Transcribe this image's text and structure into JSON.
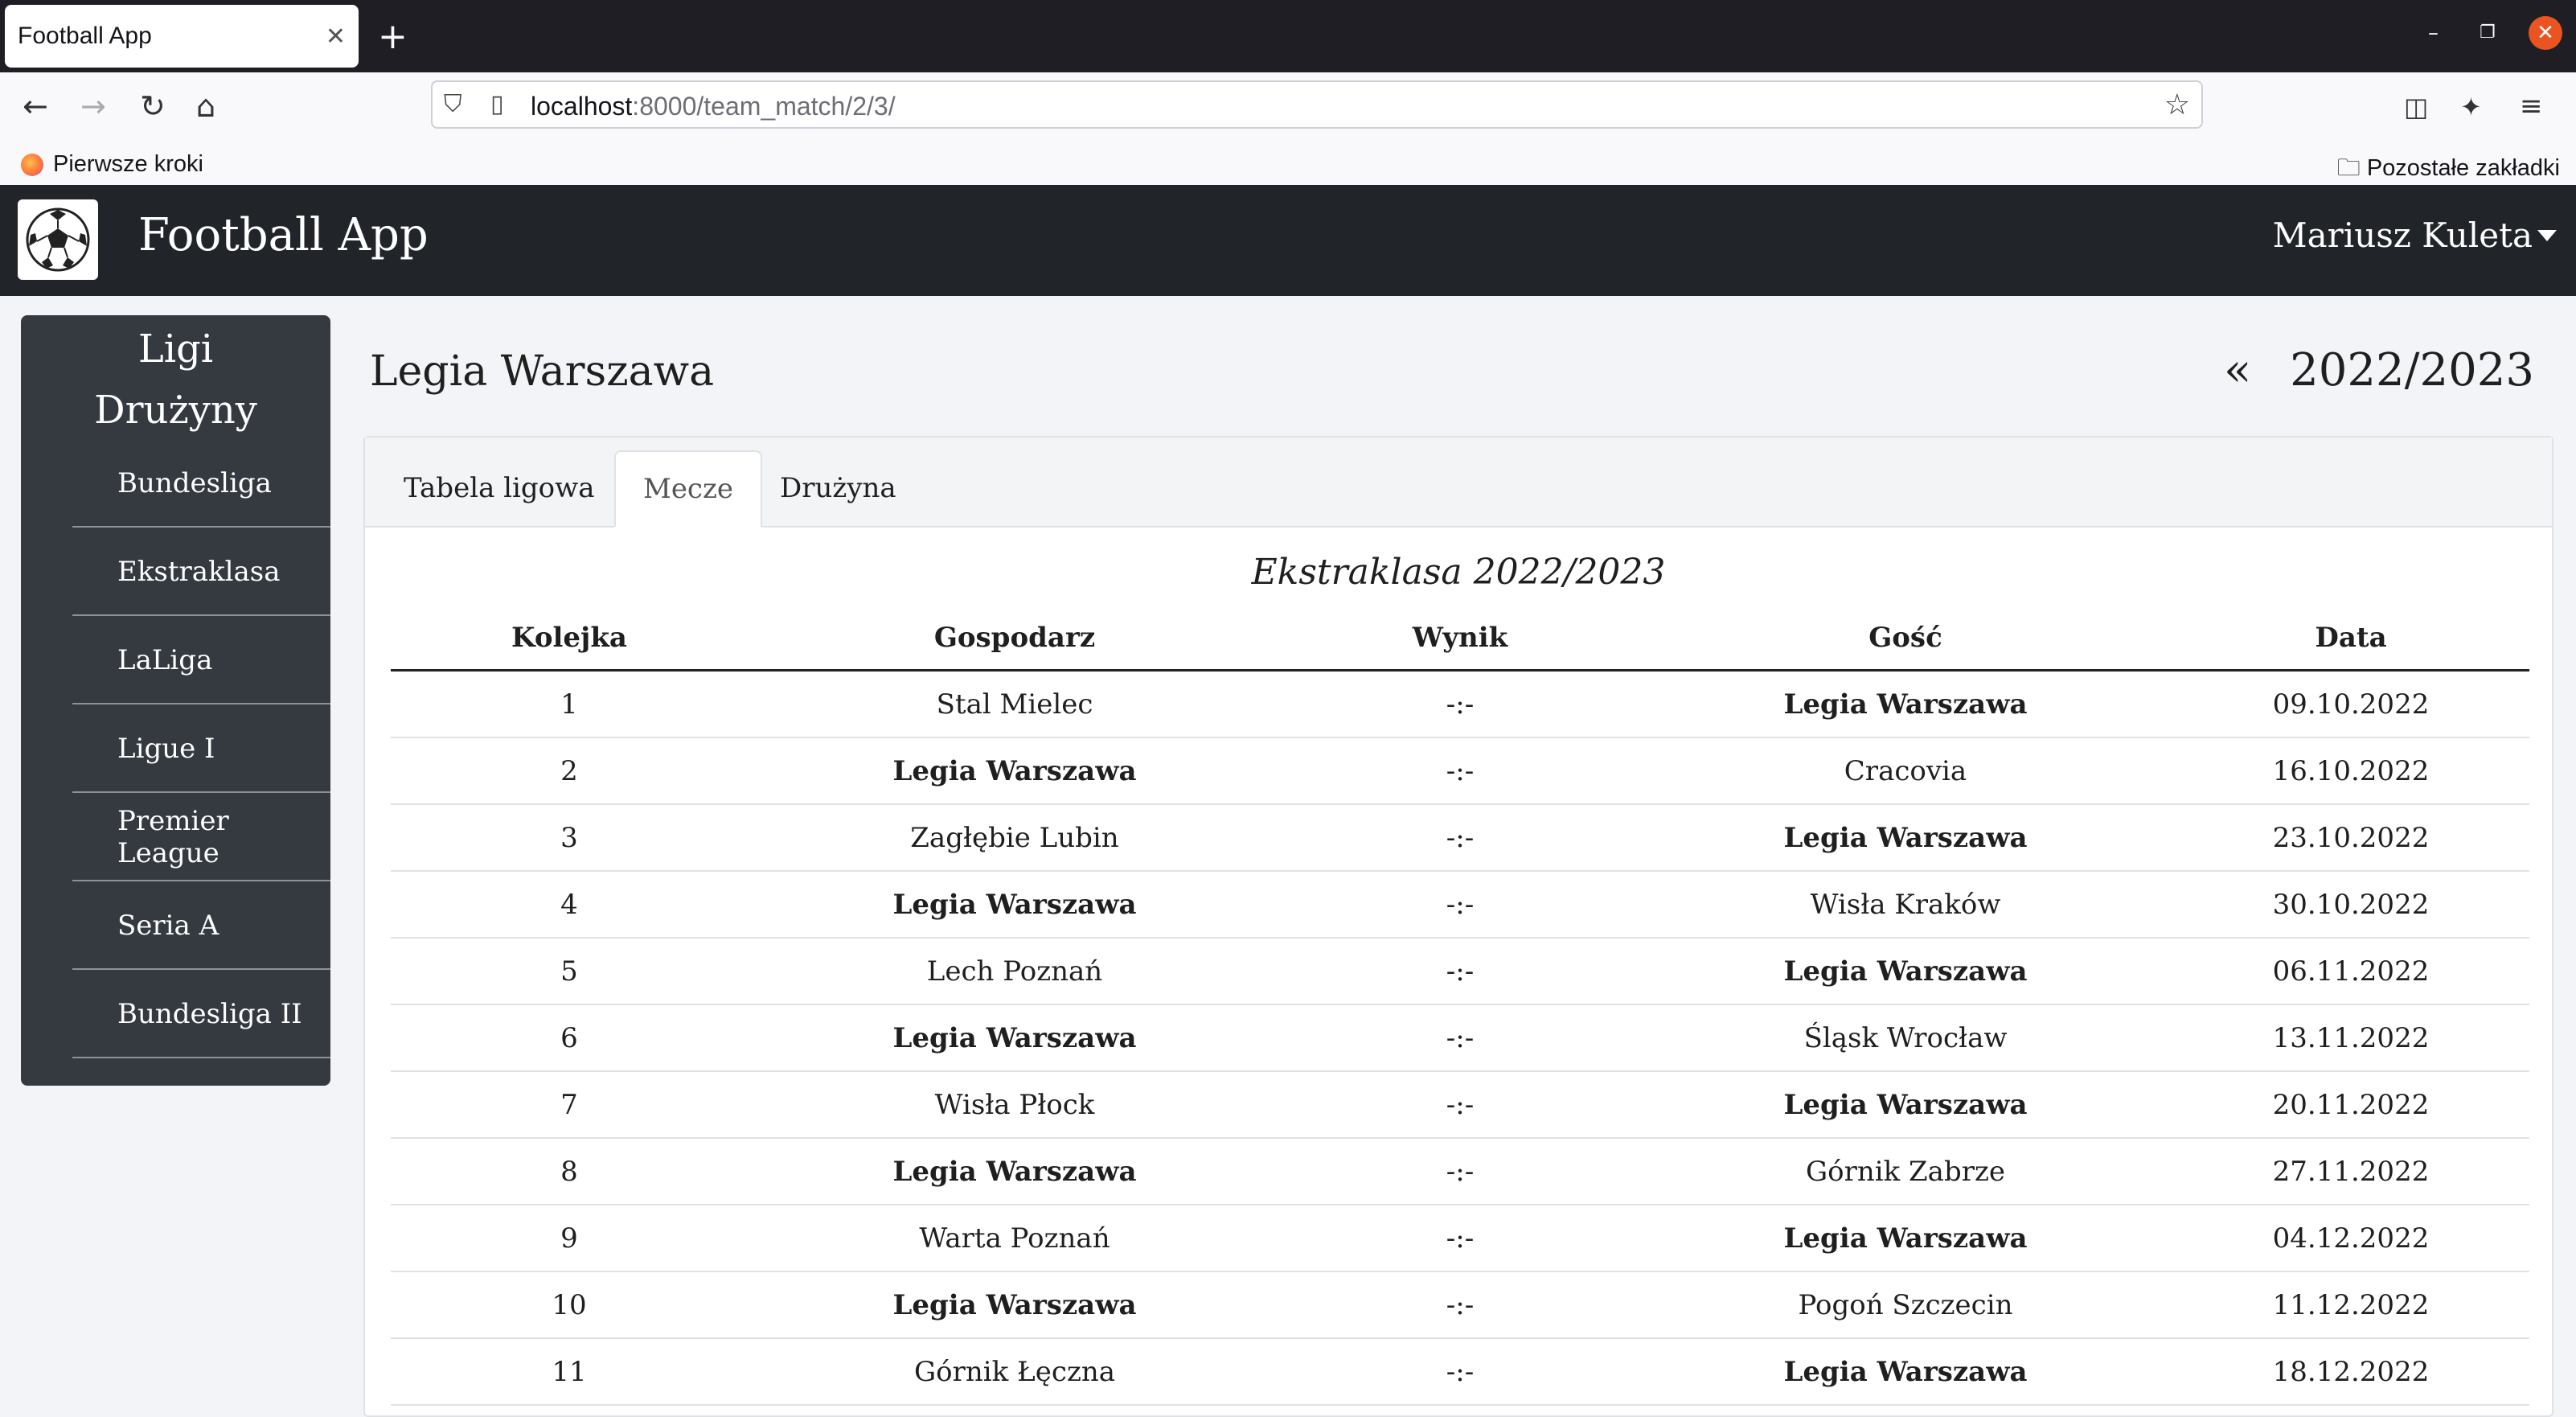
{
  "browser": {
    "tab_title": "Football App",
    "url_host": "localhost",
    "url_rest": ":8000/team_match/2/3/",
    "bookmark_first": "Pierwsze kroki",
    "bookmark_other": "Pozostałe zakładki"
  },
  "app": {
    "brand": "Football App",
    "user": "Mariusz Kuleta"
  },
  "sidebar": {
    "heading_leagues": "Ligi",
    "heading_teams": "Drużyny",
    "items": [
      {
        "label": "Bundesliga"
      },
      {
        "label": "Ekstraklasa"
      },
      {
        "label": "LaLiga"
      },
      {
        "label": "Ligue I"
      },
      {
        "label": "Premier League"
      },
      {
        "label": "Seria A"
      },
      {
        "label": "Bundesliga II"
      }
    ]
  },
  "main": {
    "team_name": "Legia Warszawa",
    "season_prev": "«",
    "season": "2022/2023",
    "tabs": [
      {
        "label": "Tabela ligowa"
      },
      {
        "label": "Mecze"
      },
      {
        "label": "Drużyna"
      }
    ],
    "table_caption": "Ekstraklasa 2022/2023",
    "columns": [
      "Kolejka",
      "Gospodarz",
      "Wynik",
      "Gość",
      "Data"
    ],
    "rows": [
      {
        "round": "1",
        "home": "Stal Mielec",
        "score": "-:-",
        "away": "Legia Warszawa",
        "date": "09.10.2022",
        "bold": "away"
      },
      {
        "round": "2",
        "home": "Legia Warszawa",
        "score": "-:-",
        "away": "Cracovia",
        "date": "16.10.2022",
        "bold": "home"
      },
      {
        "round": "3",
        "home": "Zagłębie Lubin",
        "score": "-:-",
        "away": "Legia Warszawa",
        "date": "23.10.2022",
        "bold": "away"
      },
      {
        "round": "4",
        "home": "Legia Warszawa",
        "score": "-:-",
        "away": "Wisła Kraków",
        "date": "30.10.2022",
        "bold": "home"
      },
      {
        "round": "5",
        "home": "Lech Poznań",
        "score": "-:-",
        "away": "Legia Warszawa",
        "date": "06.11.2022",
        "bold": "away"
      },
      {
        "round": "6",
        "home": "Legia Warszawa",
        "score": "-:-",
        "away": "Śląsk Wrocław",
        "date": "13.11.2022",
        "bold": "home"
      },
      {
        "round": "7",
        "home": "Wisła Płock",
        "score": "-:-",
        "away": "Legia Warszawa",
        "date": "20.11.2022",
        "bold": "away"
      },
      {
        "round": "8",
        "home": "Legia Warszawa",
        "score": "-:-",
        "away": "Górnik Zabrze",
        "date": "27.11.2022",
        "bold": "home"
      },
      {
        "round": "9",
        "home": "Warta Poznań",
        "score": "-:-",
        "away": "Legia Warszawa",
        "date": "04.12.2022",
        "bold": "away"
      },
      {
        "round": "10",
        "home": "Legia Warszawa",
        "score": "-:-",
        "away": "Pogoń Szczecin",
        "date": "11.12.2022",
        "bold": "home"
      },
      {
        "round": "11",
        "home": "Górnik Łęczna",
        "score": "-:-",
        "away": "Legia Warszawa",
        "date": "18.12.2022",
        "bold": "away"
      }
    ]
  }
}
